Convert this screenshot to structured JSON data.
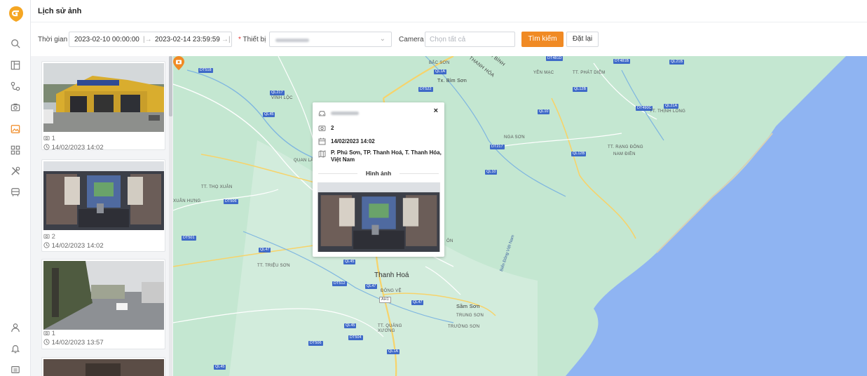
{
  "header": {
    "title": "Lịch sử ảnh"
  },
  "filters": {
    "time_label": "Thời gian",
    "date_from": "2023-02-10 00:00:00",
    "date_to": "2023-02-14 23:59:59",
    "device_required_mark": "*",
    "device_label": "Thiết bị",
    "camera_label": "Camera",
    "camera_placeholder": "Chọn tất cả",
    "search_label": "Tìm kiếm",
    "reset_label": "Đặt lại"
  },
  "images": [
    {
      "count": "1",
      "time": "14/02/2023 14:02"
    },
    {
      "count": "2",
      "time": "14/02/2023 14:02"
    },
    {
      "count": "1",
      "time": "14/02/2023 13:57"
    }
  ],
  "popup": {
    "camera": "2",
    "time": "14/02/2023 14:02",
    "address": "P. Phú Sơn, TP. Thanh Hoá, T. Thanh Hóa, Việt Nam",
    "images_heading": "Hình ảnh"
  },
  "map": {
    "city": "Thanh Hoá",
    "places": [
      "Tx. Bỉm Sơn",
      "THANH HÓA",
      "NINH BÌNH",
      "VĨNH LỘC",
      "YÊN MẠC",
      "TT. PHÁT DIỆM",
      "TT. THỊNH LONG",
      "NGA SƠN",
      "TT. RẠNG ĐÔNG",
      "NAM ĐIỀN",
      "QUAN LÀ",
      "TT. THỌ XUÂN",
      "XUÂN HƯNG",
      "TT. TRIỆU SƠN",
      "ĐÔNG VỆ",
      "Sầm Sơn",
      "TRUNG SƠN",
      "TRƯỜNG SƠN",
      "TT. QUẢNG XƯƠNG",
      "BẮC SƠN",
      "Biển Đông Việt Nam",
      "ÔN"
    ],
    "roads": [
      "DT518",
      "QL1A",
      "DT522",
      "QL217",
      "QL45",
      "DT481B",
      "QL21B",
      "QL12B",
      "QL10",
      "DT490C",
      "QL21A",
      "DT217",
      "QL12B",
      "QL10",
      "DT506",
      "DT501",
      "QL47",
      "QL45",
      "DT512",
      "QL47",
      "AH1",
      "QL47",
      "QL45",
      "DT504",
      "DT506",
      "QL1A",
      "QL45",
      "DT481D"
    ]
  },
  "colors": {
    "accent": "#f08a24",
    "sea": "#8fb4f2",
    "land": "#b9dfc8"
  }
}
